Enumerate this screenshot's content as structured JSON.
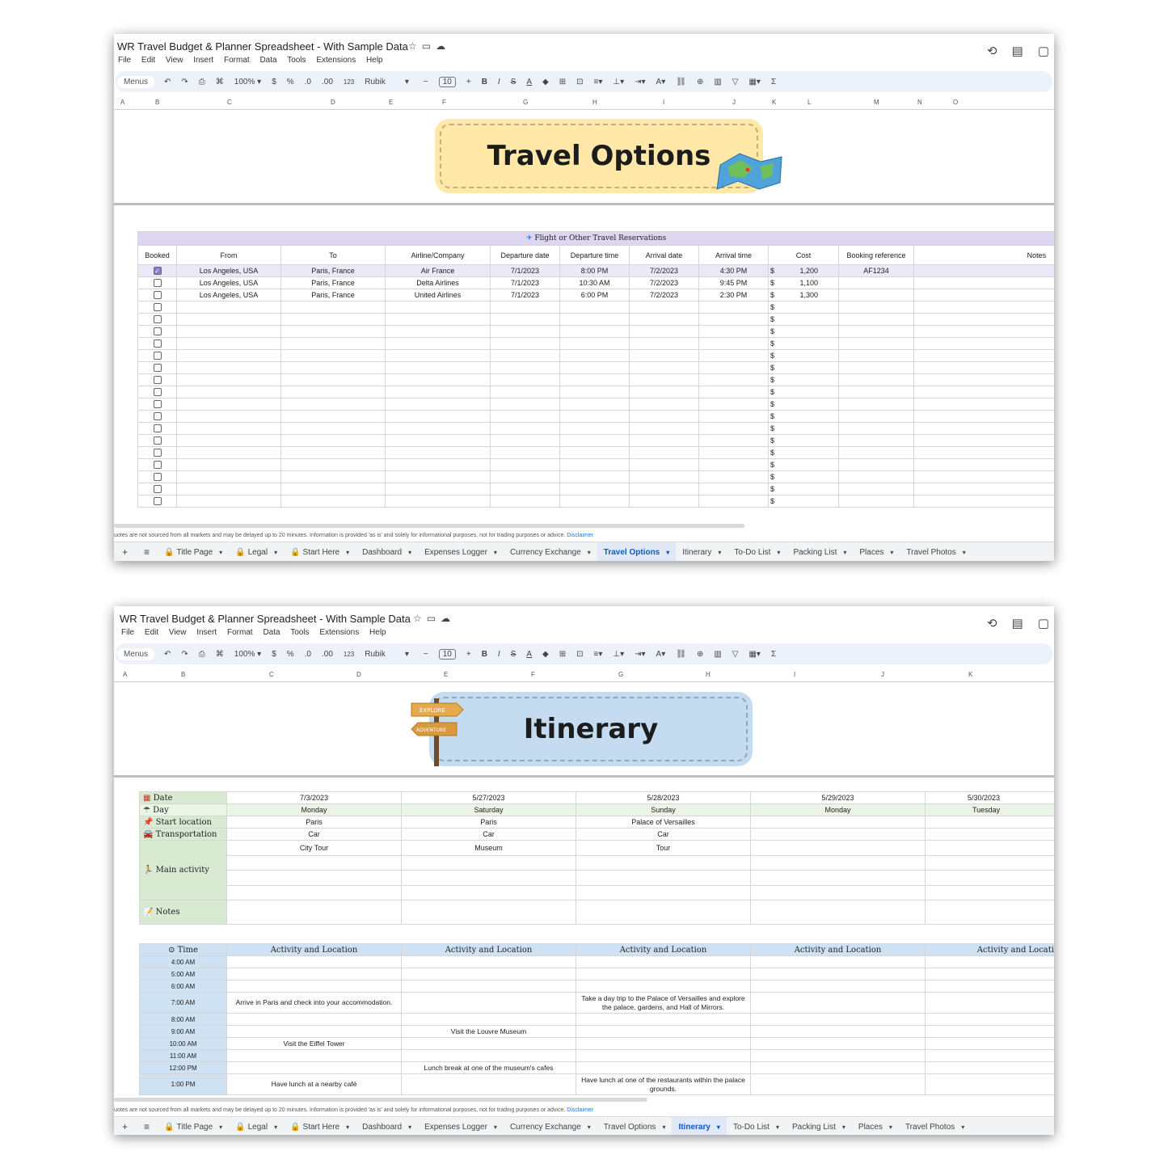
{
  "doc_title": "WR Travel Budget & Planner Spreadsheet - With Sample Data",
  "menu": [
    "File",
    "Edit",
    "View",
    "Insert",
    "Format",
    "Data",
    "Tools",
    "Extensions",
    "Help"
  ],
  "toolbar": {
    "menus_label": "Menus",
    "zoom": "100%",
    "currency": "$",
    "percent": "%",
    "dec_less": ".0",
    "dec_more": ".00",
    "number_format": "123",
    "font": "Rubik",
    "font_size": "10",
    "sum": "Σ"
  },
  "disclaimer": {
    "text": "uotes are not sourced from all markets and may be delayed up to 20 minutes. Information is provided 'as is' and solely for informational purposes, not for trading purposes or advice.",
    "link": "Disclaimer"
  },
  "sheet_tabs": [
    "Title Page",
    "Legal",
    "Start Here",
    "Dashboard",
    "Expenses Logger",
    "Currency Exchange",
    "Travel Options",
    "Itinerary",
    "To-Do List",
    "Packing List",
    "Places",
    "Travel Photos"
  ],
  "travel_options": {
    "columns_letters": [
      "A",
      "B",
      "C",
      "D",
      "E",
      "F",
      "G",
      "H",
      "I",
      "J",
      "K",
      "L",
      "M",
      "N",
      "O"
    ],
    "banner_title": "Travel Options",
    "section_title": "Flight or Other Travel Reservations",
    "headers": [
      "Booked",
      "From",
      "To",
      "Airline/Company",
      "Departure date",
      "Departure time",
      "Arrival date",
      "Arrival time",
      "Cost",
      "Booking reference",
      "Notes"
    ],
    "currency_symbol": "$",
    "rows": [
      {
        "booked": true,
        "from": "Los Angeles, USA",
        "to": "Paris, France",
        "airline": "Air France",
        "dep_date": "7/1/2023",
        "dep_time": "8:00 PM",
        "arr_date": "7/2/2023",
        "arr_time": "4:30 PM",
        "cost": "1,200",
        "ref": "AF1234",
        "notes": ""
      },
      {
        "booked": false,
        "from": "Los Angeles, USA",
        "to": "Paris, France",
        "airline": "Delta Airlines",
        "dep_date": "7/1/2023",
        "dep_time": "10:30 AM",
        "arr_date": "7/2/2023",
        "arr_time": "9:45 PM",
        "cost": "1,100",
        "ref": "",
        "notes": ""
      },
      {
        "booked": false,
        "from": "Los Angeles, USA",
        "to": "Paris, France",
        "airline": "United Airlines",
        "dep_date": "7/1/2023",
        "dep_time": "6:00 PM",
        "arr_date": "7/2/2023",
        "arr_time": "2:30 PM",
        "cost": "1,300",
        "ref": "",
        "notes": ""
      }
    ],
    "empty_rows": 17,
    "active_tab": "Travel Options"
  },
  "itinerary": {
    "columns_letters": [
      "A",
      "B",
      "C",
      "D",
      "E",
      "F",
      "G",
      "H",
      "I",
      "J",
      "K"
    ],
    "banner_title": "Itinerary",
    "sign_top": "EXPLORE",
    "sign_bottom": "ADVENTURE",
    "labels": {
      "date": "Date",
      "day": "Day",
      "start": "Start location",
      "transport": "Transportation",
      "main": "Main activity",
      "notes": "Notes",
      "time": "Time"
    },
    "days": [
      {
        "date": "7/3/2023",
        "day": "Monday",
        "start": "Paris",
        "transport": "Car",
        "activity": "City Tour"
      },
      {
        "date": "5/27/2023",
        "day": "Saturday",
        "start": "Paris",
        "transport": "Car",
        "activity": "Museum"
      },
      {
        "date": "5/28/2023",
        "day": "Sunday",
        "start": "Palace of Versailles",
        "transport": "Car",
        "activity": "Tour"
      },
      {
        "date": "5/29/2023",
        "day": "Monday",
        "start": "",
        "transport": "",
        "activity": ""
      },
      {
        "date": "5/30/2023",
        "day": "Tuesday",
        "start": "",
        "transport": "",
        "activity": ""
      }
    ],
    "activity_header": [
      "Activity and Location",
      "Activity and Location",
      "Activity and Location",
      "Activity and Location",
      "Activity and Locatio"
    ],
    "schedule": [
      {
        "time": "4:00 AM",
        "cells": [
          "",
          "",
          "",
          "",
          ""
        ]
      },
      {
        "time": "5:00 AM",
        "cells": [
          "",
          "",
          "",
          "",
          ""
        ]
      },
      {
        "time": "6:00 AM",
        "cells": [
          "",
          "",
          "",
          "",
          ""
        ]
      },
      {
        "time": "7:00 AM",
        "cells": [
          "Arrive in Paris and check into your accommodation.",
          "",
          "Take a day trip to the Palace of Versailles and explore the palace, gardens, and Hall of Mirrors.",
          "",
          ""
        ],
        "tall": true
      },
      {
        "time": "8:00 AM",
        "cells": [
          "",
          "",
          "",
          "",
          ""
        ]
      },
      {
        "time": "9:00 AM",
        "cells": [
          "",
          "Visit the Louvre Museum",
          "",
          "",
          ""
        ]
      },
      {
        "time": "10:00 AM",
        "cells": [
          "Visit the Eiffel Tower",
          "",
          "",
          "",
          ""
        ]
      },
      {
        "time": "11:00 AM",
        "cells": [
          "",
          "",
          "",
          "",
          ""
        ]
      },
      {
        "time": "12:00 PM",
        "cells": [
          "",
          "Lunch break at one of the museum's cafes",
          "",
          "",
          ""
        ]
      },
      {
        "time": "1:00 PM",
        "cells": [
          "Have lunch at a nearby café",
          "",
          "Have lunch at one of the restaurants within the palace grounds.",
          "",
          ""
        ],
        "tall": true
      }
    ],
    "active_tab": "Itinerary"
  }
}
